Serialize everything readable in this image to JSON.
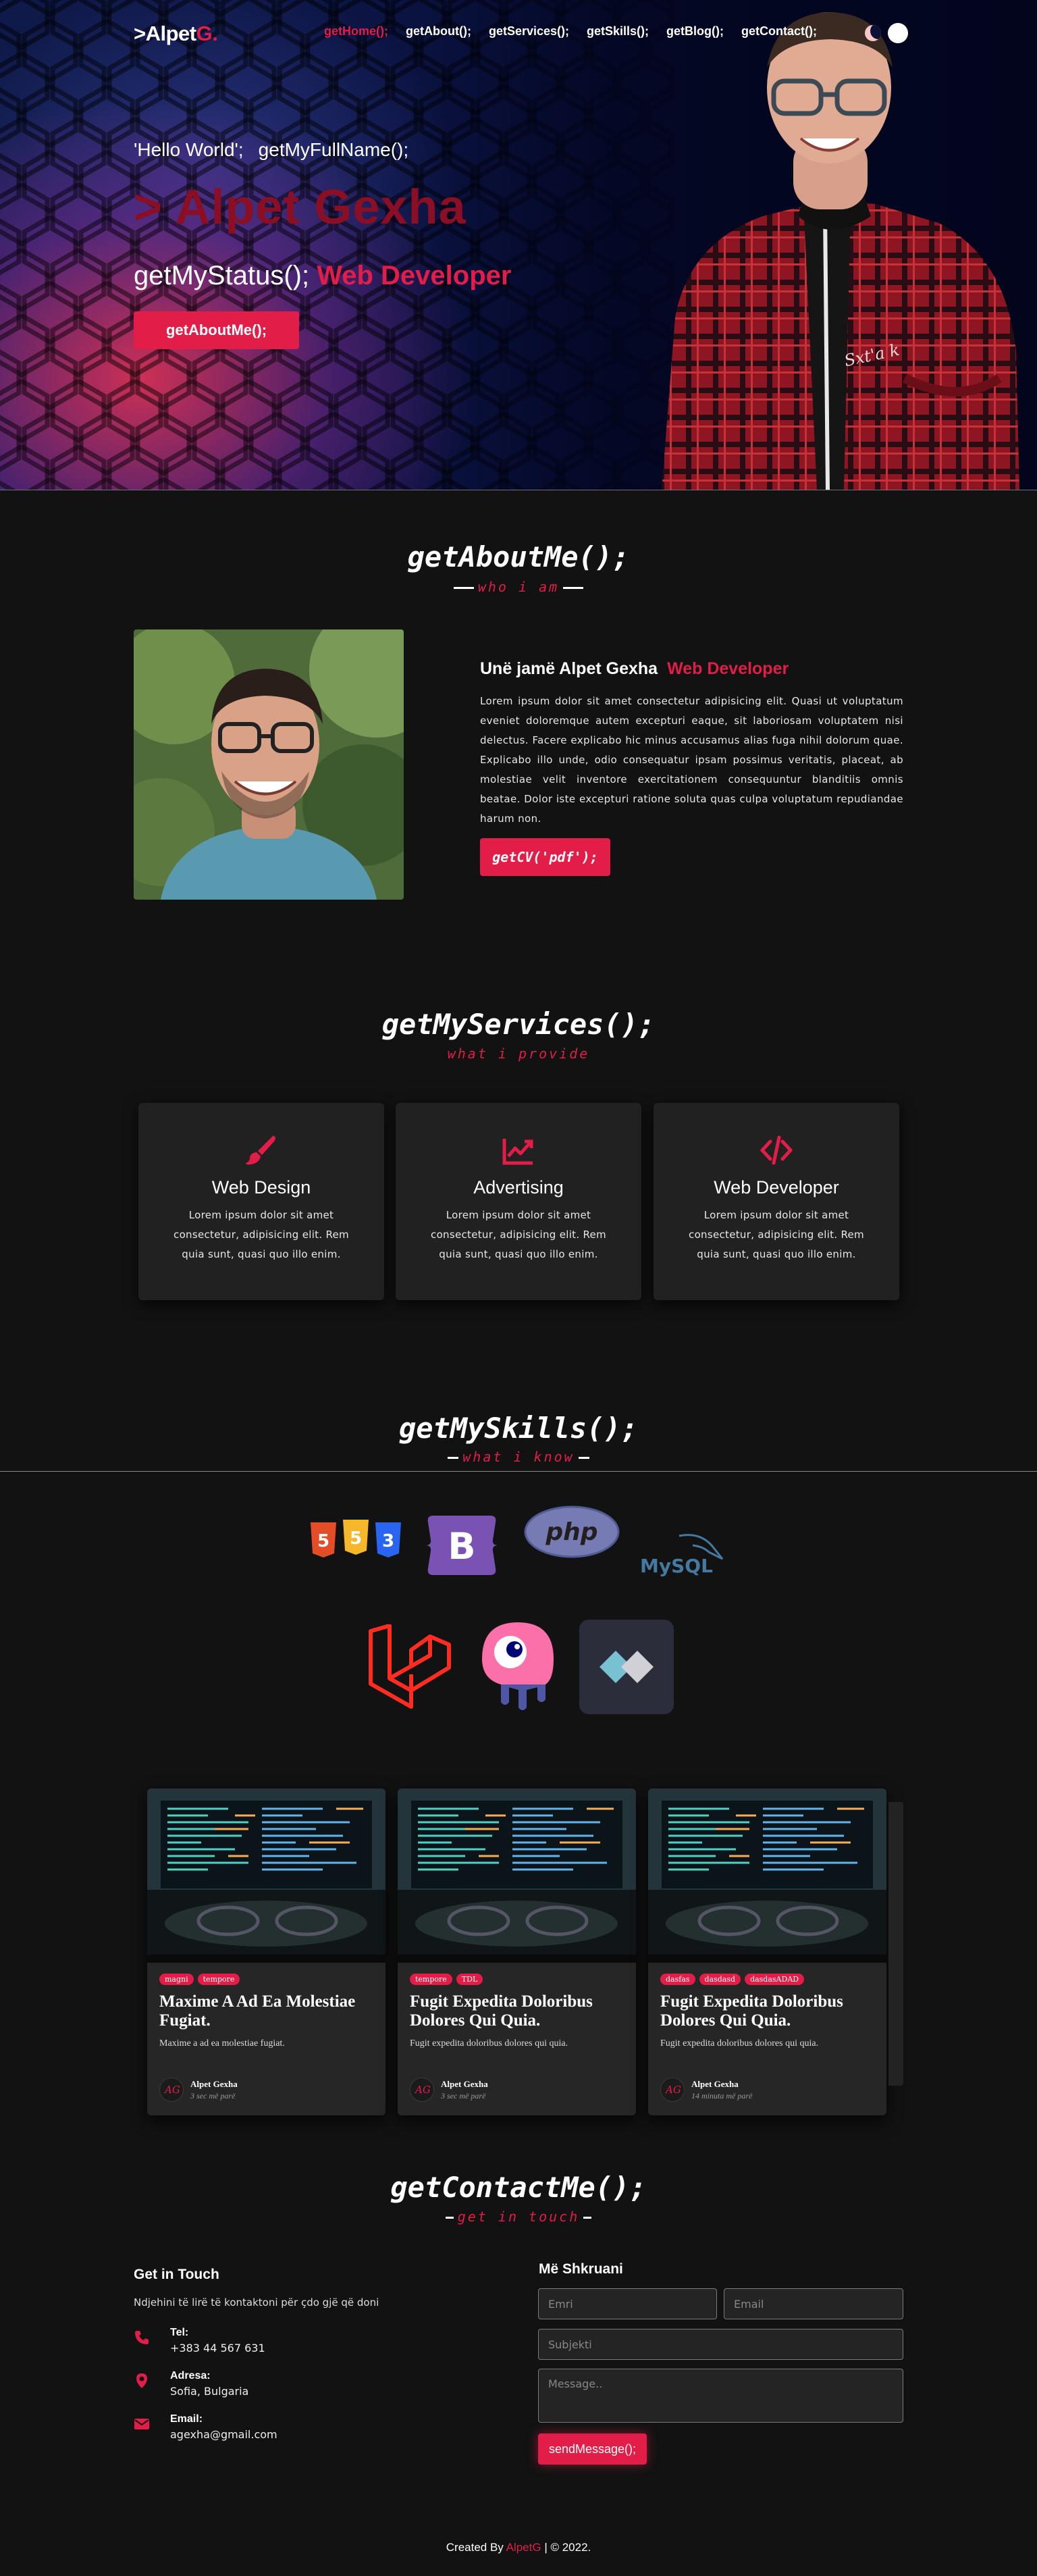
{
  "header": {
    "logo_prefix": ">Alpet",
    "logo_accent": "G.",
    "nav": [
      {
        "label": "getHome();",
        "active": true
      },
      {
        "label": "getAbout();",
        "active": false
      },
      {
        "label": "getServices();",
        "active": false
      },
      {
        "label": "getSkills();",
        "active": false
      },
      {
        "label": "getBlog();",
        "active": false
      },
      {
        "label": "getContact();",
        "active": false
      }
    ],
    "theme_toggle": {
      "dark_icon": "moon-icon",
      "light_icon": "sun-icon"
    }
  },
  "hero": {
    "hello": "'Hello World';",
    "fullname_call": "getMyFullName();",
    "name": "> Alpet Gexha",
    "status_call": "getMyStatus();",
    "status_role": "Web Developer",
    "button_label": "getAboutMe();",
    "signature": "Sxt'a k"
  },
  "about": {
    "title": "getAboutMe();",
    "subtitle": "who i am",
    "heading": "Unë jamë Alpet Gexha",
    "role": "Web Developer",
    "text": "Lorem ipsum dolor sit amet consectetur adipisicing elit. Quasi ut voluptatum eveniet doloremque autem excepturi eaque, sit laboriosam voluptatem nisi delectus. Facere explicabo hic minus accusamus alias fuga nihil dolorum quae. Explicabo illo unde, odio consequatur ipsam possimus veritatis, placeat, ab molestiae velit inventore exercitationem consequuntur blanditiis omnis beatae. Dolor iste excepturi ratione soluta quas culpa voluptatum repudiandae harum non.",
    "cv_button": "getCV('pdf');"
  },
  "services": {
    "title": "getMyServices();",
    "subtitle": "what i provide",
    "items": [
      {
        "icon": "paint-brush-icon",
        "title": "Web Design",
        "text": "Lorem ipsum dolor sit amet consectetur, adipisicing elit. Rem quia sunt, quasi quo illo enim."
      },
      {
        "icon": "chart-line-icon",
        "title": "Advertising",
        "text": "Lorem ipsum dolor sit amet consectetur, adipisicing elit. Rem quia sunt, quasi quo illo enim."
      },
      {
        "icon": "code-icon",
        "title": "Web Developer",
        "text": "Lorem ipsum dolor sit amet consectetur, adipisicing elit. Rem quia sunt, quasi quo illo enim."
      }
    ]
  },
  "skills": {
    "title": "getMySkills();",
    "subtitle": "what i know",
    "items": [
      {
        "icon": "html-css-js-icon",
        "digits": [
          "5",
          "5",
          "3"
        ]
      },
      {
        "icon": "bootstrap-icon",
        "label": "B"
      },
      {
        "icon": "php-icon",
        "label": "php"
      },
      {
        "icon": "mysql-icon",
        "label": "MySQL"
      },
      {
        "icon": "laravel-icon"
      },
      {
        "icon": "livewire-icon"
      },
      {
        "icon": "alpine-js-icon"
      }
    ]
  },
  "blog": {
    "posts": [
      {
        "tags": [
          "magni",
          "tempore"
        ],
        "title": "Maxime A Ad Ea Molestiae Fugiat.",
        "excerpt": "Maxime a ad ea molestiae fugiat.",
        "author": "Alpet Gexha",
        "time": "3 sec më parë"
      },
      {
        "tags": [
          "tempore",
          "TDL"
        ],
        "title": "Fugit Expedita Doloribus Dolores Qui Quia.",
        "excerpt": "Fugit expedita doloribus dolores qui quia.",
        "author": "Alpet Gexha",
        "time": "3 sec më parë"
      },
      {
        "tags": [
          "dasfas",
          "dasdasd",
          "dasdasADAD"
        ],
        "title": "Fugit Expedita Doloribus Dolores Qui Quia.",
        "excerpt": "Fugit expedita doloribus dolores qui quia.",
        "author": "Alpet Gexha",
        "time": "14 minuta më parë"
      }
    ]
  },
  "contact": {
    "title": "getContactMe();",
    "subtitle": "get in touch",
    "info_heading": "Get in Touch",
    "info_desc": "Ndjehini të lirë të kontaktoni për çdo gjë që doni",
    "items": [
      {
        "icon": "phone-icon",
        "label": "Tel:",
        "value": "+383 44 567 631"
      },
      {
        "icon": "map-pin-icon",
        "label": "Adresa:",
        "value": "Sofia, Bulgaria"
      },
      {
        "icon": "envelope-icon",
        "label": "Email:",
        "value": "agexha@gmail.com"
      }
    ],
    "form_heading": "Më Shkruani",
    "placeholders": {
      "name": "Emri",
      "email": "Email",
      "subject": "Subjekti",
      "message": "Message.."
    },
    "send_button": "sendMessage();"
  },
  "footer": {
    "prefix": "Created By",
    "accent": "AlpetG",
    "suffix": "| © 2022."
  },
  "colors": {
    "accent": "#e11d48",
    "background": "#121212",
    "card": "#212121"
  }
}
